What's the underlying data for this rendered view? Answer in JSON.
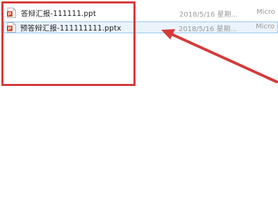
{
  "files": [
    {
      "name": "答辩汇报-111111.ppt",
      "date": "2018/5/16 星期...",
      "type": "Micro",
      "icon": "powerpoint-file-icon",
      "selected": false
    },
    {
      "name": "预答辩汇报-111111111.pptx",
      "date": "2018/5/16 星期...",
      "type": "Micro",
      "icon": "powerpoint-file-icon",
      "selected": true
    }
  ],
  "colors": {
    "highlight": "#d43a3a",
    "arrow": "#d43a3a",
    "selection_bg": "#eaf3fc",
    "selection_border": "#99c6ee",
    "icon_accent": "#d24726"
  }
}
